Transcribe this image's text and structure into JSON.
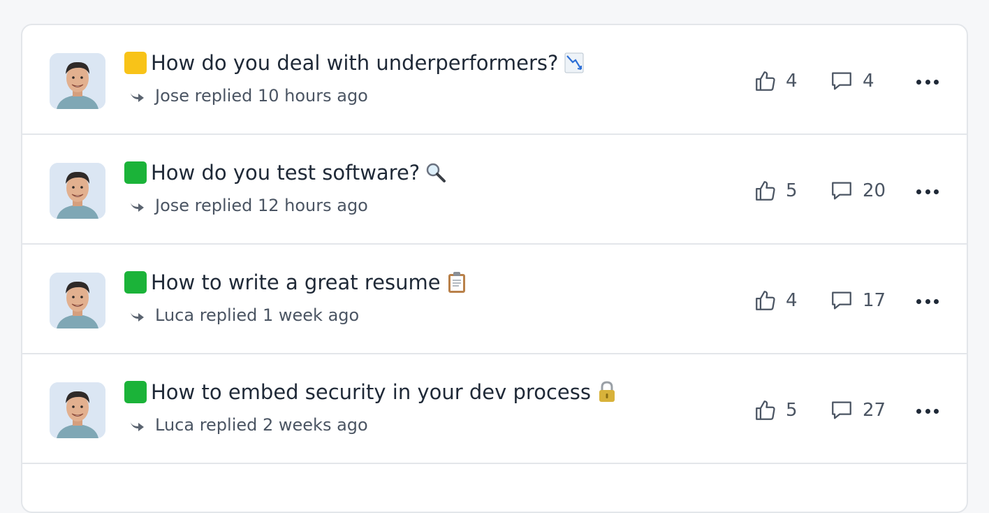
{
  "colors": {
    "status_yellow": "#f8c318",
    "status_green": "#1bb339",
    "text_primary": "#1f2937",
    "text_secondary": "#4b5563",
    "border": "#e3e6ea"
  },
  "threads": [
    {
      "status": "yellow",
      "title": "How do you deal with underperformers?",
      "emoji_icon": "chart-decreasing-icon",
      "reply_text": "Jose replied 10 hours ago",
      "likes": "4",
      "comments": "4"
    },
    {
      "status": "green",
      "title": "How do you test software?",
      "emoji_icon": "magnifying-glass-icon",
      "reply_text": "Jose replied 12 hours ago",
      "likes": "5",
      "comments": "20"
    },
    {
      "status": "green",
      "title": "How to write a great resume",
      "emoji_icon": "clipboard-icon",
      "reply_text": "Luca replied 1 week ago",
      "likes": "4",
      "comments": "17"
    },
    {
      "status": "green",
      "title": "How to embed security in your dev process",
      "emoji_icon": "lock-icon",
      "reply_text": "Luca replied 2 weeks ago",
      "likes": "5",
      "comments": "27"
    }
  ]
}
